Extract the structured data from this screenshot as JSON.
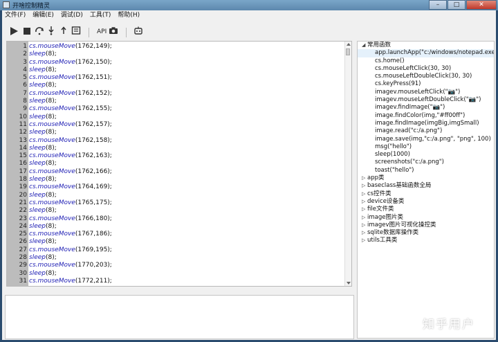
{
  "window": {
    "title": "开啥控制精灵"
  },
  "menu": [
    "文件(F)",
    "编辑(E)",
    "调试(D)",
    "工具(T)",
    "帮助(H)"
  ],
  "toolbar": {
    "api_label": "API"
  },
  "editor": {
    "lines": [
      {
        "n": "1",
        "obj": "cs.",
        "fn": "mouseMove",
        "args": "(1762,149);"
      },
      {
        "n": "2",
        "obj": "",
        "fn": "sleep",
        "args": "(8);"
      },
      {
        "n": "3",
        "obj": "cs.",
        "fn": "mouseMove",
        "args": "(1762,150);"
      },
      {
        "n": "4",
        "obj": "",
        "fn": "sleep",
        "args": "(8);"
      },
      {
        "n": "5",
        "obj": "cs.",
        "fn": "mouseMove",
        "args": "(1762,151);"
      },
      {
        "n": "6",
        "obj": "",
        "fn": "sleep",
        "args": "(8);"
      },
      {
        "n": "7",
        "obj": "cs.",
        "fn": "mouseMove",
        "args": "(1762,152);"
      },
      {
        "n": "8",
        "obj": "",
        "fn": "sleep",
        "args": "(8);"
      },
      {
        "n": "9",
        "obj": "cs.",
        "fn": "mouseMove",
        "args": "(1762,155);"
      },
      {
        "n": "10",
        "obj": "",
        "fn": "sleep",
        "args": "(8);"
      },
      {
        "n": "11",
        "obj": "cs.",
        "fn": "mouseMove",
        "args": "(1762,157);"
      },
      {
        "n": "12",
        "obj": "",
        "fn": "sleep",
        "args": "(8);"
      },
      {
        "n": "13",
        "obj": "cs.",
        "fn": "mouseMove",
        "args": "(1762,158);"
      },
      {
        "n": "14",
        "obj": "",
        "fn": "sleep",
        "args": "(8);"
      },
      {
        "n": "15",
        "obj": "cs.",
        "fn": "mouseMove",
        "args": "(1762,163);"
      },
      {
        "n": "16",
        "obj": "",
        "fn": "sleep",
        "args": "(8);"
      },
      {
        "n": "17",
        "obj": "cs.",
        "fn": "mouseMove",
        "args": "(1762,166);"
      },
      {
        "n": "18",
        "obj": "",
        "fn": "sleep",
        "args": "(8);"
      },
      {
        "n": "19",
        "obj": "cs.",
        "fn": "mouseMove",
        "args": "(1764,169);"
      },
      {
        "n": "20",
        "obj": "",
        "fn": "sleep",
        "args": "(8);"
      },
      {
        "n": "21",
        "obj": "cs.",
        "fn": "mouseMove",
        "args": "(1765,175);"
      },
      {
        "n": "22",
        "obj": "",
        "fn": "sleep",
        "args": "(8);"
      },
      {
        "n": "23",
        "obj": "cs.",
        "fn": "mouseMove",
        "args": "(1766,180);"
      },
      {
        "n": "24",
        "obj": "",
        "fn": "sleep",
        "args": "(8);"
      },
      {
        "n": "25",
        "obj": "cs.",
        "fn": "mouseMove",
        "args": "(1767,186);"
      },
      {
        "n": "26",
        "obj": "",
        "fn": "sleep",
        "args": "(8);"
      },
      {
        "n": "27",
        "obj": "cs.",
        "fn": "mouseMove",
        "args": "(1769,195);"
      },
      {
        "n": "28",
        "obj": "",
        "fn": "sleep",
        "args": "(8);"
      },
      {
        "n": "29",
        "obj": "cs.",
        "fn": "mouseMove",
        "args": "(1770,203);"
      },
      {
        "n": "30",
        "obj": "",
        "fn": "sleep",
        "args": "(8);"
      },
      {
        "n": "31",
        "obj": "cs.",
        "fn": "mouseMove",
        "args": "(1772,211);"
      }
    ]
  },
  "tree": {
    "root_label": "常用函数",
    "common": [
      "app.launchApp(\"c:/windows/notepad.exe\")",
      "cs.home()",
      "cs.mouseLeftClick(30, 30)",
      "cs.mouseLeftDoubleClick(30, 30)",
      "cs.keyPress(91)",
      "imagev.mouseLeftClick(\"📷\")",
      "imagev.mouseLeftDoubleClick(\"📷\")",
      "imagev.findImage(\"📷\")",
      "image.findColor(img,\"#ff00ff\")",
      "image.findImage(imgBig,imgSmall)",
      "image.read(\"c:/a.png\")",
      "image.save(img,\"c:/a.png\", \"png\", 100)",
      "msg(\"hello\")",
      "sleep(1000)",
      "screenshots(\"c:/a.png\")",
      "toast(\"hello\")"
    ],
    "categories": [
      "app类",
      "baseclass基础函数全局",
      "cs控件类",
      "device设备类",
      "file文件类",
      "image图片类",
      "imagev图片可视化操控类",
      "sqlite数据库操作类",
      "utils工具类"
    ]
  },
  "watermark": "知乎用户"
}
